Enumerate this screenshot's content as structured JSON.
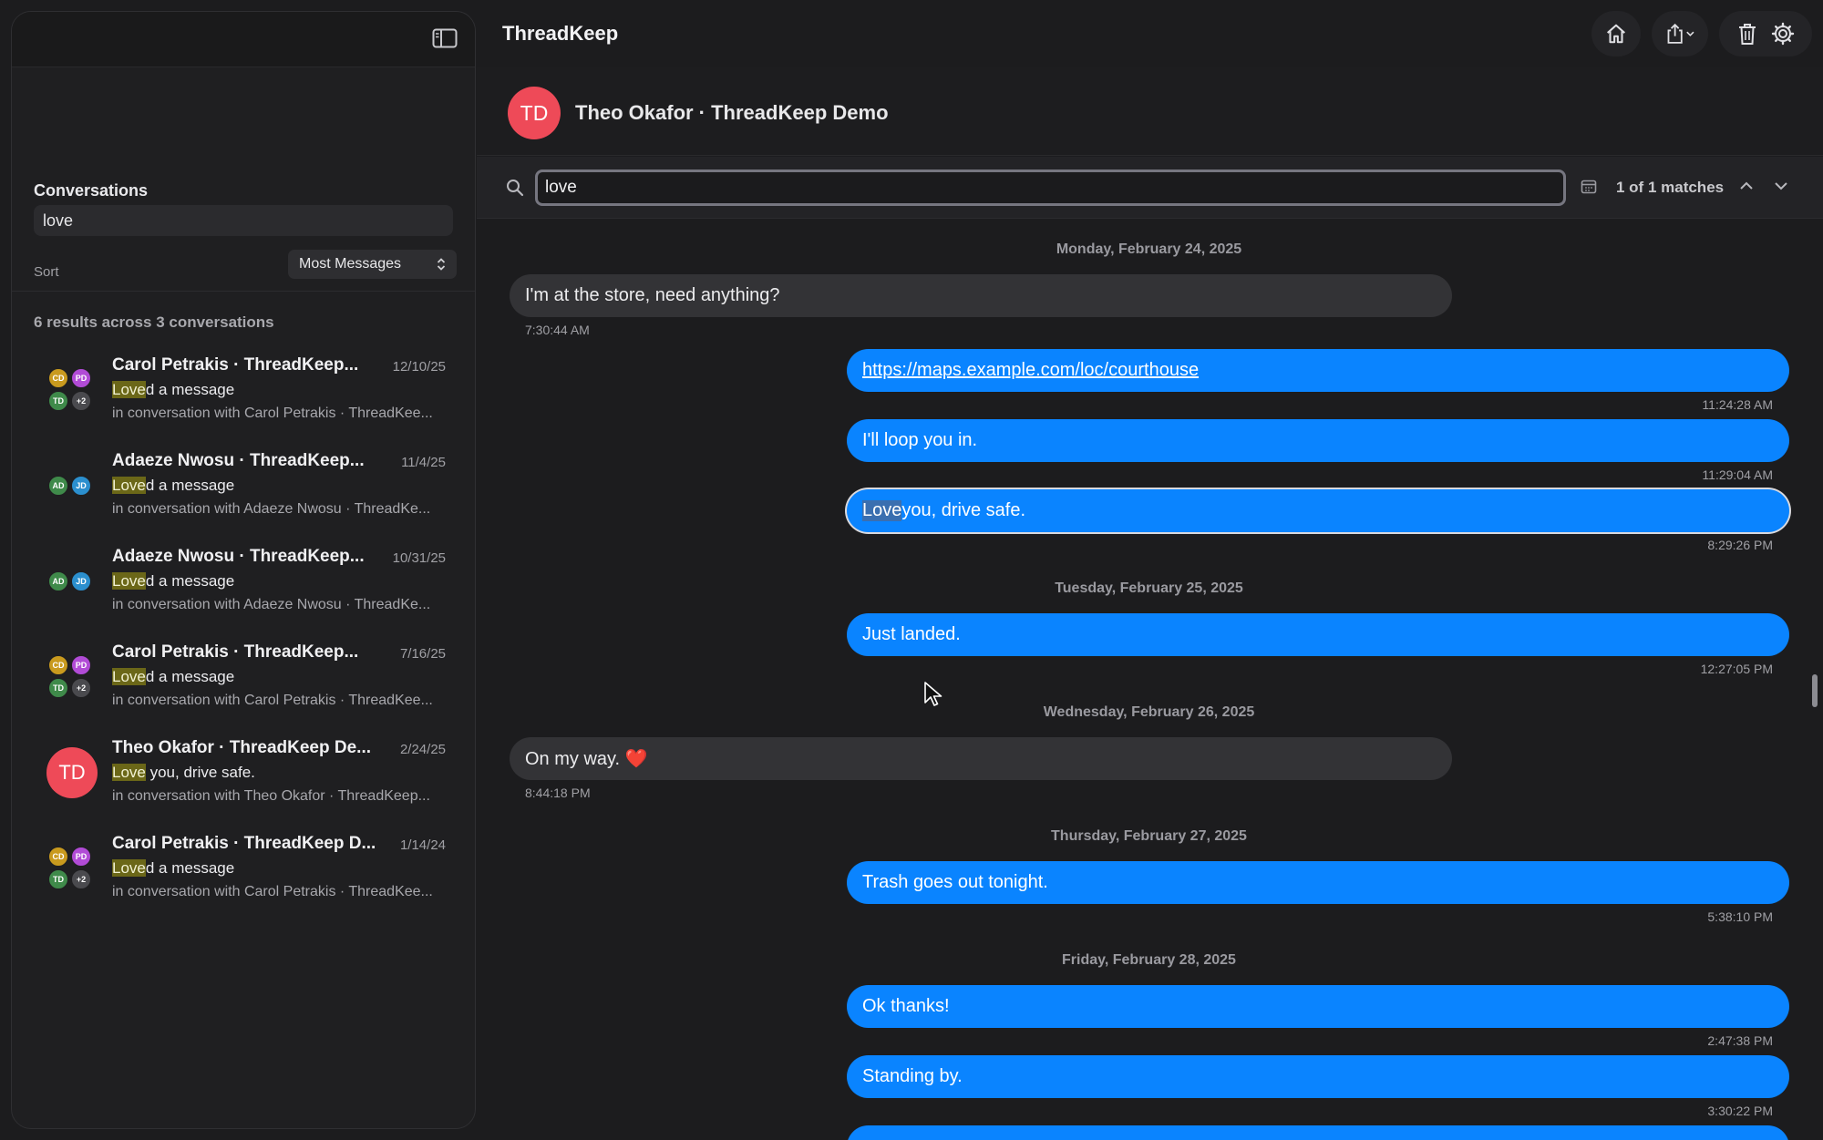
{
  "app": {
    "title": "ThreadKeep"
  },
  "sidebar": {
    "section_title": "Conversations",
    "search_value": "love",
    "sort_label": "Sort",
    "sort_value": "Most Messages",
    "results_summary": "6 results across 3 conversations",
    "items": [
      {
        "name": "Carol Petrakis · ThreadKeep...",
        "date": "12/10/25",
        "hl": "Love",
        "rest": "d a message",
        "sub": "in conversation with Carol Petrakis · ThreadKee...",
        "avatars": [
          "CD",
          "PD",
          "TD",
          "+2"
        ]
      },
      {
        "name": "Adaeze Nwosu · ThreadKeep...",
        "date": "11/4/25",
        "hl": "Love",
        "rest": "d a message",
        "sub": "in conversation with Adaeze Nwosu · ThreadKe...",
        "avatars": [
          "AD",
          "JD"
        ]
      },
      {
        "name": "Adaeze Nwosu · ThreadKeep...",
        "date": "10/31/25",
        "hl": "Love",
        "rest": "d a message",
        "sub": "in conversation with Adaeze Nwosu · ThreadKe...",
        "avatars": [
          "AD",
          "JD"
        ]
      },
      {
        "name": "Carol Petrakis · ThreadKeep...",
        "date": "7/16/25",
        "hl": "Love",
        "rest": "d a message",
        "sub": "in conversation with Carol Petrakis · ThreadKee...",
        "avatars": [
          "CD",
          "PD",
          "TD",
          "+2"
        ]
      },
      {
        "name": "Theo Okafor · ThreadKeep De...",
        "date": "2/24/25",
        "hl": "Love",
        "rest": " you, drive safe.",
        "sub": "in conversation with Theo Okafor · ThreadKeep...",
        "avatars": [
          "TD"
        ]
      },
      {
        "name": "Carol Petrakis · ThreadKeep D...",
        "date": "1/14/24",
        "hl": "Love",
        "rest": "d a message",
        "sub": "in conversation with Carol Petrakis · ThreadKee...",
        "avatars": [
          "CD",
          "PD",
          "TD",
          "+2"
        ]
      }
    ]
  },
  "conversation": {
    "avatar": "TD",
    "title": "Theo Okafor · ThreadKeep Demo",
    "search_value": "love",
    "match_count": "1 of 1 matches"
  },
  "messages": {
    "day1": "Monday, February 24, 2025",
    "m1": "I'm at the store, need anything?",
    "t1": "7:30:44 AM",
    "m2": "https://maps.example.com/loc/courthouse",
    "t2": "11:24:28 AM",
    "m3": "I'll loop you in.",
    "t3": "11:29:04 AM",
    "m4_hl": "Love",
    "m4_rest": " you, drive safe.",
    "t4": "8:29:26 PM",
    "day2": "Tuesday, February 25, 2025",
    "m5": "Just landed.",
    "t5": "12:27:05 PM",
    "day3": "Wednesday, February 26, 2025",
    "m6": "On my way. ❤️",
    "t6": "8:44:18 PM",
    "day4": "Thursday, February 27, 2025",
    "m7": "Trash goes out tonight.",
    "t7": "5:38:10 PM",
    "day5": "Friday, February 28, 2025",
    "m8": "Ok thanks!",
    "t8": "2:47:38 PM",
    "m9": "Standing by.",
    "t9": "3:30:22 PM"
  },
  "colors": {
    "accent": "#0a84ff",
    "highlight": "#6b6718",
    "avatar_red": "#ee4a58",
    "CD": "#c99a1e",
    "PD": "#b14bd6",
    "TD": "#3f8a4a",
    "+2": "#4a4a4e",
    "AD": "#3f8a4a",
    "JD": "#2b8fce"
  }
}
